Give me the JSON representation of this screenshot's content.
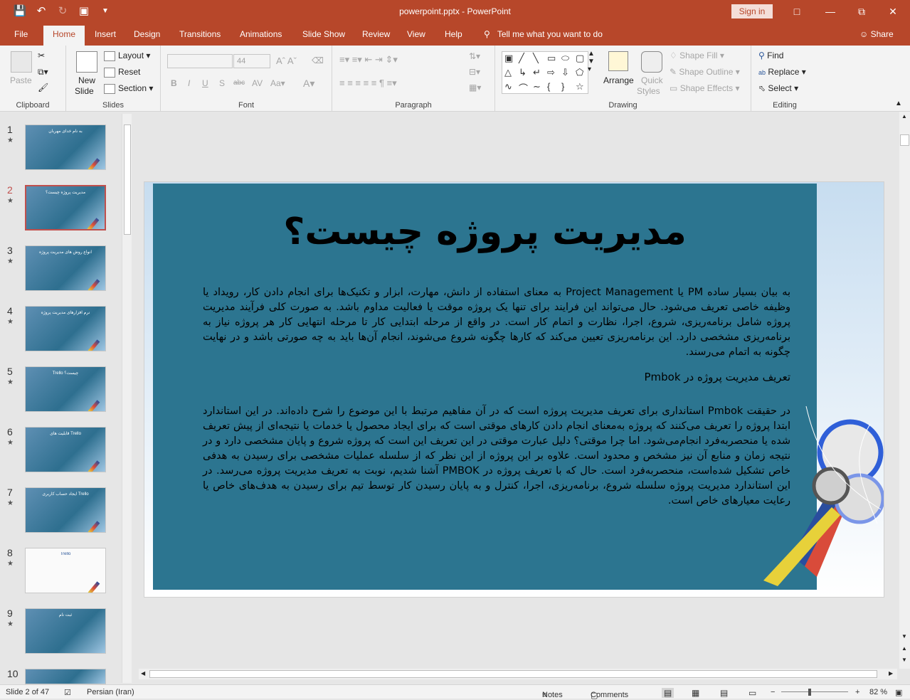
{
  "window": {
    "title": "powerpoint.pptx  -  PowerPoint",
    "signin": "Sign in",
    "qat_icons": [
      "save-icon",
      "undo-icon",
      "redo-icon",
      "presenter-icon",
      "customize-qat-icon"
    ],
    "controls": [
      "ribbon-display-icon",
      "minimize-icon",
      "restore-icon",
      "close-icon"
    ]
  },
  "tabs": {
    "items": [
      "File",
      "Home",
      "Insert",
      "Design",
      "Transitions",
      "Animations",
      "Slide Show",
      "Review",
      "View",
      "Help"
    ],
    "active": "Home",
    "tellme": "Tell me what you want to do",
    "share": "Share"
  },
  "ribbon": {
    "clipboard": {
      "label": "Clipboard",
      "paste": "Paste"
    },
    "slides": {
      "label": "Slides",
      "new_slide_1": "New",
      "new_slide_2": "Slide",
      "layout": "Layout",
      "reset": "Reset",
      "section": "Section"
    },
    "font": {
      "label": "Font",
      "size": "44"
    },
    "paragraph": {
      "label": "Paragraph"
    },
    "drawing": {
      "label": "Drawing",
      "arrange": "Arrange",
      "quick_styles_1": "Quick",
      "quick_styles_2": "Styles",
      "shape_fill": "Shape Fill",
      "shape_outline": "Shape Outline",
      "shape_effects": "Shape Effects"
    },
    "editing": {
      "label": "Editing",
      "find": "Find",
      "replace": "Replace",
      "select": "Select"
    }
  },
  "thumbnails": [
    {
      "num": "1",
      "title": "به نام خدای مهربان",
      "selected": false
    },
    {
      "num": "2",
      "title": "مدیریت پروژه چیست؟",
      "selected": true
    },
    {
      "num": "3",
      "title": "انواع روش های مدیریت پروژه",
      "selected": false
    },
    {
      "num": "4",
      "title": "نرم افزارهای مدیریت پروژه",
      "selected": false
    },
    {
      "num": "5",
      "title": "Trello چیست؟",
      "selected": false
    },
    {
      "num": "6",
      "title": "قابلیت های Trello",
      "selected": false
    },
    {
      "num": "7",
      "title": "ایجاد حساب کاربری Trello",
      "selected": false
    },
    {
      "num": "8",
      "title": "Trello",
      "selected": false
    },
    {
      "num": "9",
      "title": "ثبت نام",
      "selected": false
    },
    {
      "num": "10",
      "title": "",
      "selected": false
    }
  ],
  "slide": {
    "heading": "مدیریت پروژه چیست؟",
    "para1": "به بیان بسیار ساده PM یا Project Management به معنای استفاده از دانش، مهارت، ابزار و تکنیک‌ها برای انجام دادن کار، رویداد یا وظیفه خاصی تعریف می‌شود. حال می‌تواند این فرایند برای تنها یک پروژه موقت یا فعالیت مداوم باشد. به صورت کلی فرآیند مدیریت پروژه شامل برنامه‌ریزی، شروع، اجرا، نظارت و اتمام کار است. در واقع از مرحله ابتدایی کار تا مرحله انتهایی کار هر پروژه نیاز به برنامه‌ریزی مشخصی دارد. این برنامه‌ریزی تعیین می‌کند که کارها چگونه شروع می‌شوند، انجام آن‌ها باید به چه صورتی باشد و در نهایت چگونه به اتمام می‌رسند.",
    "subhead": "تعریف مدیریت پروژه در Pmbok",
    "para2": "در حقیقت Pmbok استانداری برای تعریف مدیریت پروژه است که در آن مفاهیم مرتبط با این موضوع را شرح داده‌اند. در این استاندارد ابتدا پروژه را تعریف می‌کنند که پروژه به‌معنای انجام دادن کارهای موقتی است که برای ایجاد محصول یا خدمات یا نتیجه‌ای از پیش تعریف شده یا منحصربه‌فرد انجام‌می‌شود. اما چرا موقتی؟ دلیل عبارت موقتی در این تعریف این است که پروژه شروع و پایان مشخصی دارد و در نتیجه زمان و منابع آن نیز مشخص و محدود است. علاوه بر این پروژه از این نظر که از سلسله عملیات مشخصی برای رسیدن به هدفی خاص تشکیل شده‌است، منحصربه‌فرد است. حال که با تعریف پروژه در PMBOK آشنا شدیم، نوبت به تعریف مدیریت پروژه می‌رسد. در این استاندارد مدیریت پروژه سلسله شروع، برنامه‌ریزی، اجرا، کنترل و به پایان رسیدن کار توسط تیم برای رسیدن به هدف‌های خاص یا رعایت معیارهای خاص است."
  },
  "status": {
    "slide_info": "Slide 2 of 47",
    "language": "Persian (Iran)",
    "notes": "Notes",
    "comments": "Comments",
    "zoom": "82 %"
  },
  "colors": {
    "accent": "#b7472a",
    "slide_panel": "#2c7590"
  }
}
